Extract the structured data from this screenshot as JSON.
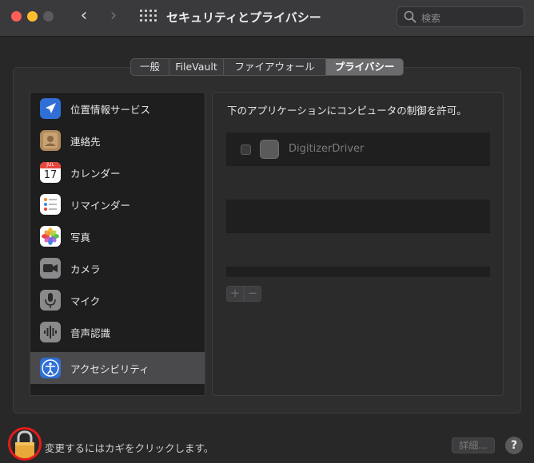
{
  "window": {
    "title": "セキュリティとプライバシー",
    "search_placeholder": "検索"
  },
  "tabs": [
    {
      "label": "一般",
      "active": false
    },
    {
      "label": "FileVault",
      "active": false
    },
    {
      "label": "ファイアウォール",
      "active": false
    },
    {
      "label": "プライバシー",
      "active": true
    }
  ],
  "sidebar": {
    "items": [
      {
        "label": "位置情報サービス",
        "icon": "location-arrow-icon"
      },
      {
        "label": "連絡先",
        "icon": "contacts-icon"
      },
      {
        "label": "カレンダー",
        "icon": "calendar-icon",
        "icon_month": "JUL",
        "icon_day": "17"
      },
      {
        "label": "リマインダー",
        "icon": "reminders-icon"
      },
      {
        "label": "写真",
        "icon": "photos-icon"
      },
      {
        "label": "カメラ",
        "icon": "camera-icon"
      },
      {
        "label": "マイク",
        "icon": "microphone-icon"
      },
      {
        "label": "音声認識",
        "icon": "speech-recognition-icon"
      },
      {
        "label": "アクセシビリティ",
        "icon": "accessibility-icon",
        "selected": true
      }
    ]
  },
  "panel": {
    "description": "下のアプリケーションにコンピュータの制御を許可。",
    "apps": [
      {
        "name": "DigitizerDriver",
        "checked": false
      }
    ],
    "add_label": "+",
    "remove_label": "−"
  },
  "footer": {
    "lock_text": "変更するにはカギをクリックします。",
    "details_label": "詳細...",
    "help_label": "?"
  },
  "colors": {
    "window_bg": "#282828",
    "selected_row": "#4a4a4c",
    "annotation_ring": "#e51b1b"
  }
}
